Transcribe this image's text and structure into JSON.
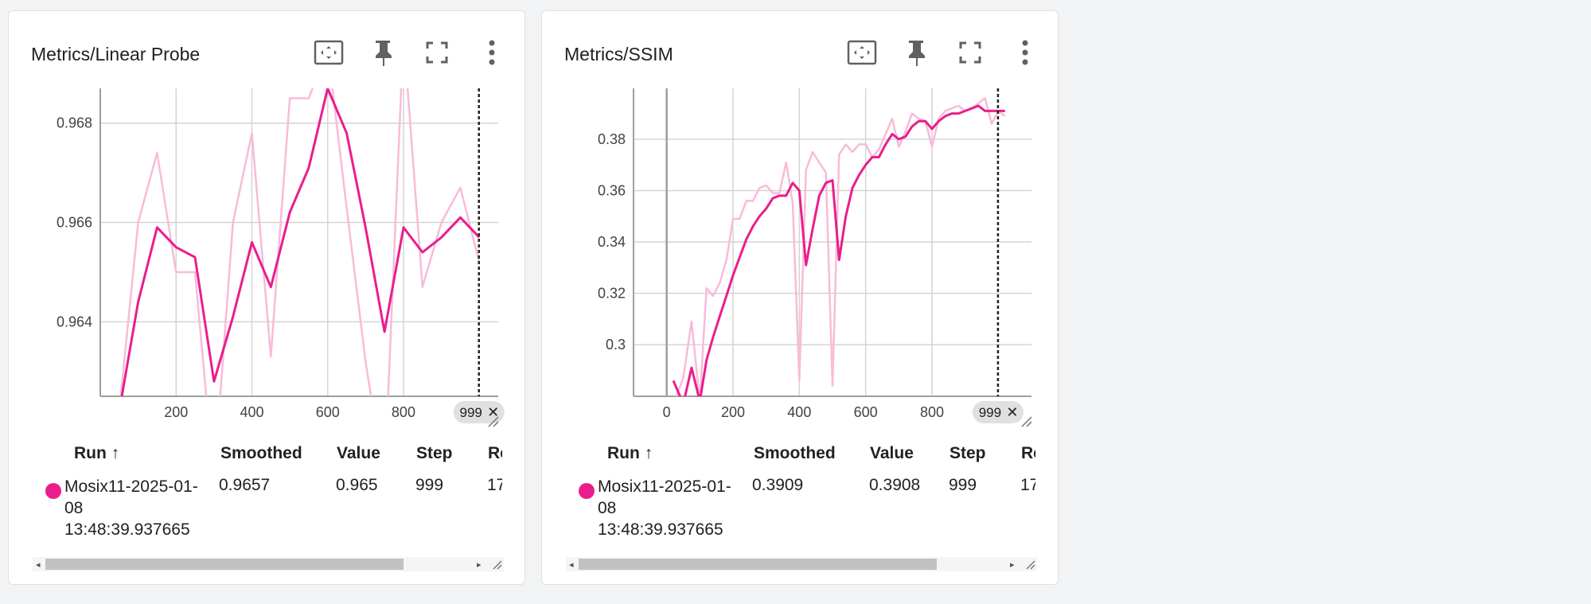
{
  "cards": [
    {
      "title": "Metrics/Linear Probe",
      "icons": [
        "fit-domain-icon",
        "pin-icon",
        "fullscreen-icon",
        "more-vert-icon"
      ],
      "chart_data": {
        "type": "line",
        "xlabel": "",
        "ylabel": "",
        "xlim": [
          0,
          1050
        ],
        "ylim": [
          0.9625,
          0.9687
        ],
        "x_ticks": [
          200,
          400,
          600,
          800
        ],
        "y_ticks": [
          0.964,
          0.966,
          0.968
        ],
        "y_tick_labels": [
          "0.964",
          "0.966",
          "0.968"
        ],
        "hover_step_label": "999",
        "hover_step": 999,
        "series": [
          {
            "role": "raw",
            "color": "#f8bbd9",
            "x": [
              50,
              100,
              150,
              200,
              250,
              300,
              350,
              400,
              450,
              500,
              550,
              600,
              650,
              700,
              750,
              800,
              850,
              900,
              950,
              1000
            ],
            "values": [
              0.9622,
              0.966,
              0.9674,
              0.965,
              0.965,
              0.9608,
              0.966,
              0.9678,
              0.9633,
              0.9685,
              0.9685,
              0.9695,
              0.9663,
              0.9632,
              0.9608,
              0.9698,
              0.9647,
              0.966,
              0.9667,
              0.9652
            ]
          },
          {
            "role": "smoothed",
            "color": "#e91e8c",
            "x": [
              50,
              100,
              150,
              200,
              250,
              300,
              350,
              400,
              450,
              500,
              550,
              600,
              650,
              700,
              750,
              800,
              850,
              900,
              950,
              1000
            ],
            "values": [
              0.9622,
              0.9644,
              0.9659,
              0.9655,
              0.9653,
              0.9628,
              0.9641,
              0.9656,
              0.9647,
              0.9662,
              0.9671,
              0.9687,
              0.9678,
              0.9659,
              0.9638,
              0.9659,
              0.9654,
              0.9657,
              0.9661,
              0.9657
            ]
          }
        ]
      },
      "table": {
        "headers": [
          "Run ↑",
          "Smoothed",
          "Value",
          "Step",
          "Re"
        ],
        "run_name": "Mosix11-2025-01-08 13:48:39.937665",
        "smoothed": "0.9657",
        "value": "0.965",
        "step": "999",
        "relative": "17"
      }
    },
    {
      "title": "Metrics/SSIM",
      "icons": [
        "fit-domain-icon",
        "pin-icon",
        "fullscreen-icon",
        "more-vert-icon"
      ],
      "chart_data": {
        "type": "line",
        "xlabel": "",
        "ylabel": "",
        "xlim": [
          -100,
          1100
        ],
        "ylim": [
          0.2799,
          0.3998
        ],
        "x_ticks": [
          0,
          200,
          400,
          600,
          800
        ],
        "y_ticks": [
          0.3,
          0.32,
          0.34,
          0.36,
          0.38
        ],
        "y_tick_labels": [
          "0.3",
          "0.32",
          "0.34",
          "0.36",
          "0.38"
        ],
        "hover_step_label": "999",
        "hover_step": 999,
        "series": [
          {
            "role": "raw",
            "color": "#f8bbd9",
            "x": [
              20,
              50,
              75,
              100,
              120,
              140,
              160,
              180,
              200,
              220,
              240,
              260,
              280,
              300,
              320,
              340,
              360,
              380,
              400,
              420,
              440,
              460,
              480,
              500,
              520,
              540,
              560,
              580,
              600,
              620,
              640,
              660,
              680,
              700,
              720,
              740,
              760,
              780,
              800,
              820,
              840,
              860,
              880,
              900,
              920,
              940,
              960,
              980,
              1000,
              1020
            ],
            "values": [
              0.277,
              0.287,
              0.309,
              0.278,
              0.322,
              0.319,
              0.324,
              0.333,
              0.349,
              0.349,
              0.356,
              0.356,
              0.361,
              0.362,
              0.359,
              0.359,
              0.371,
              0.355,
              0.286,
              0.368,
              0.375,
              0.371,
              0.367,
              0.284,
              0.374,
              0.378,
              0.375,
              0.378,
              0.378,
              0.373,
              0.376,
              0.382,
              0.388,
              0.377,
              0.383,
              0.39,
              0.388,
              0.387,
              0.377,
              0.388,
              0.391,
              0.392,
              0.393,
              0.391,
              0.392,
              0.394,
              0.396,
              0.386,
              0.391,
              0.389
            ]
          },
          {
            "role": "smoothed",
            "color": "#e91e8c",
            "x": [
              20,
              50,
              75,
              100,
              120,
              140,
              160,
              180,
              200,
              220,
              240,
              260,
              280,
              300,
              320,
              340,
              360,
              380,
              400,
              420,
              440,
              460,
              480,
              500,
              520,
              540,
              560,
              580,
              600,
              620,
              640,
              660,
              680,
              700,
              720,
              740,
              760,
              780,
              800,
              820,
              840,
              860,
              880,
              900,
              920,
              940,
              960,
              980,
              1000,
              1020
            ],
            "values": [
              0.286,
              0.277,
              0.291,
              0.278,
              0.294,
              0.303,
              0.311,
              0.319,
              0.327,
              0.334,
              0.341,
              0.346,
              0.35,
              0.353,
              0.357,
              0.358,
              0.358,
              0.363,
              0.36,
              0.331,
              0.345,
              0.358,
              0.363,
              0.364,
              0.333,
              0.35,
              0.361,
              0.366,
              0.37,
              0.373,
              0.373,
              0.378,
              0.382,
              0.38,
              0.381,
              0.385,
              0.387,
              0.387,
              0.384,
              0.387,
              0.389,
              0.39,
              0.39,
              0.391,
              0.392,
              0.393,
              0.391,
              0.391,
              0.391,
              0.391
            ]
          }
        ]
      },
      "table": {
        "headers": [
          "Run ↑",
          "Smoothed",
          "Value",
          "Step",
          "Re"
        ],
        "run_name": "Mosix11-2025-01-08 13:48:39.937665",
        "smoothed": "0.3909",
        "value": "0.3908",
        "step": "999",
        "relative": "17"
      }
    }
  ],
  "colors": {
    "run": "#e91e8c",
    "raw": "#f8bbd9",
    "grid": "#d4d4d4",
    "axis": "#9e9e9e",
    "icon": "#616161"
  }
}
